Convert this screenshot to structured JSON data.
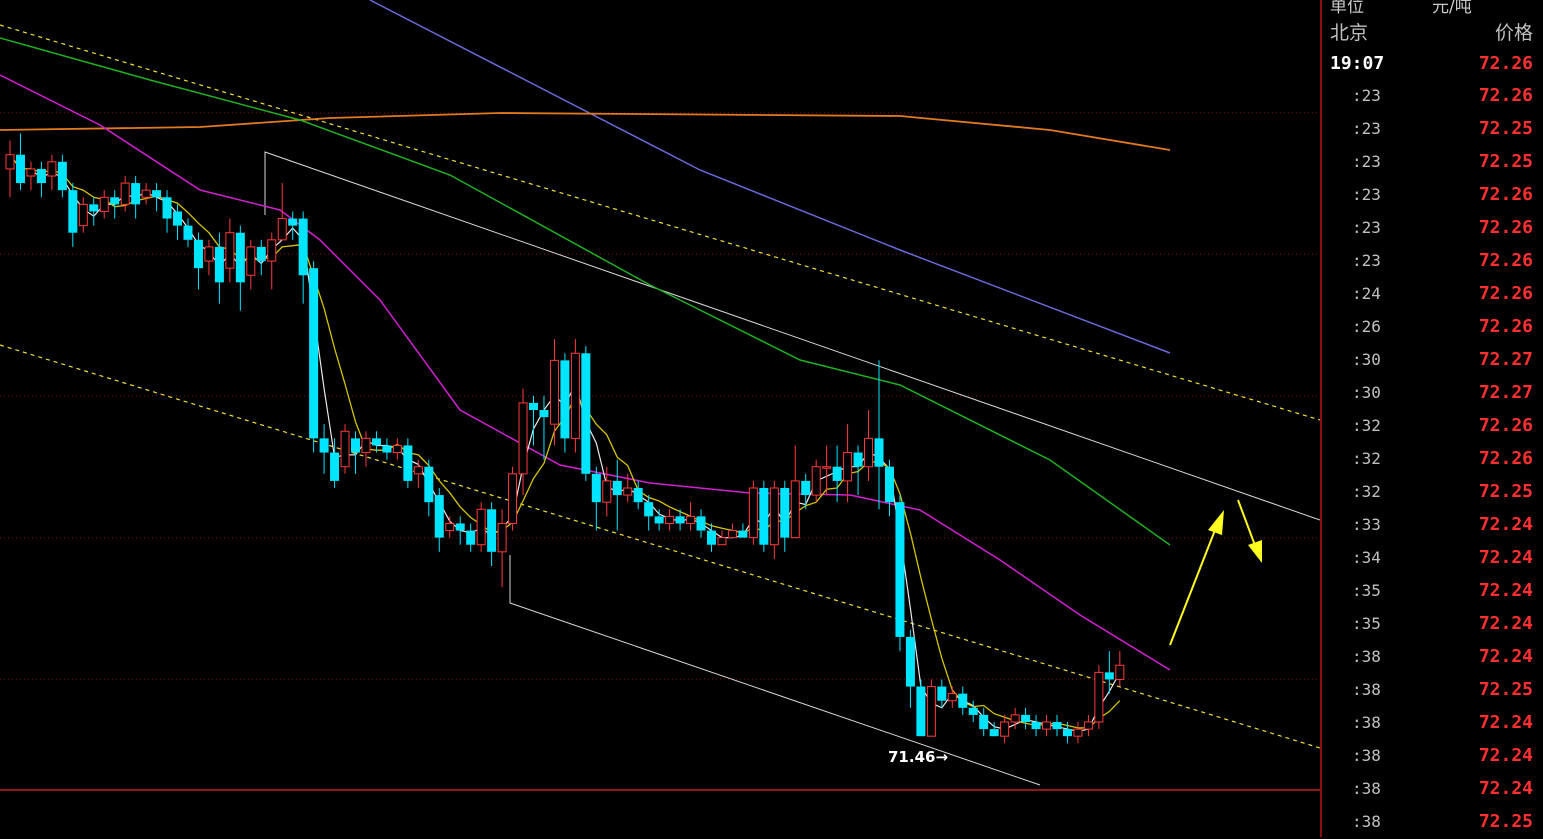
{
  "header": {
    "unit_label": "单位",
    "unit_value": "元/吨"
  },
  "panel": {
    "city": "北京",
    "price_header": "价格",
    "first": {
      "time": "19:07",
      "price": "72.26"
    },
    "rows": [
      {
        "time": ":23",
        "price": "72.26"
      },
      {
        "time": ":23",
        "price": "72.25"
      },
      {
        "time": ":23",
        "price": "72.25"
      },
      {
        "time": ":23",
        "price": "72.26"
      },
      {
        "time": ":23",
        "price": "72.26"
      },
      {
        "time": ":23",
        "price": "72.26"
      },
      {
        "time": ":24",
        "price": "72.26"
      },
      {
        "time": ":26",
        "price": "72.26"
      },
      {
        "time": ":30",
        "price": "72.27"
      },
      {
        "time": ":30",
        "price": "72.27"
      },
      {
        "time": ":32",
        "price": "72.26"
      },
      {
        "time": ":32",
        "price": "72.26"
      },
      {
        "time": ":32",
        "price": "72.25"
      },
      {
        "time": ":33",
        "price": "72.24"
      },
      {
        "time": ":34",
        "price": "72.24"
      },
      {
        "time": ":35",
        "price": "72.24"
      },
      {
        "time": ":35",
        "price": "72.24"
      },
      {
        "time": ":38",
        "price": "72.24"
      },
      {
        "time": ":38",
        "price": "72.25"
      },
      {
        "time": ":38",
        "price": "72.24"
      },
      {
        "time": ":38",
        "price": "72.24"
      },
      {
        "time": ":38",
        "price": "72.24"
      },
      {
        "time": ":38",
        "price": "72.25"
      }
    ]
  },
  "colors": {
    "up": "#ff3b3b",
    "down": "#00e5ff",
    "ma_white": "#e8e8e8",
    "ma_yellow": "#d4c400",
    "ma_magenta": "#d020d0",
    "ma_green": "#20b020",
    "ma_blue": "#6a6ad8",
    "ma_orange": "#e07a20",
    "channel_yellow": "#f0e030",
    "trend_white": "#d8d8d8",
    "grid": "#8a1010",
    "arrow": "#ffff20"
  },
  "chart_data": {
    "type": "candlestick",
    "ylim": [
      71.35,
      72.45
    ],
    "low_label": "71.46",
    "candles": [
      [
        72.24,
        72.26,
        72.2,
        72.28
      ],
      [
        72.26,
        72.22,
        72.21,
        72.29
      ],
      [
        72.23,
        72.24,
        72.21,
        72.25
      ],
      [
        72.24,
        72.22,
        72.2,
        72.25
      ],
      [
        72.23,
        72.25,
        72.21,
        72.26
      ],
      [
        72.25,
        72.21,
        72.2,
        72.26
      ],
      [
        72.21,
        72.15,
        72.13,
        72.22
      ],
      [
        72.16,
        72.19,
        72.15,
        72.2
      ],
      [
        72.19,
        72.18,
        72.16,
        72.2
      ],
      [
        72.18,
        72.2,
        72.17,
        72.21
      ],
      [
        72.2,
        72.19,
        72.17,
        72.21
      ],
      [
        72.19,
        72.22,
        72.18,
        72.23
      ],
      [
        72.22,
        72.19,
        72.17,
        72.23
      ],
      [
        72.2,
        72.21,
        72.19,
        72.22
      ],
      [
        72.21,
        72.2,
        72.18,
        72.22
      ],
      [
        72.2,
        72.17,
        72.15,
        72.21
      ],
      [
        72.18,
        72.16,
        72.14,
        72.19
      ],
      [
        72.16,
        72.14,
        72.13,
        72.17
      ],
      [
        72.14,
        72.1,
        72.07,
        72.15
      ],
      [
        72.11,
        72.13,
        72.09,
        72.14
      ],
      [
        72.13,
        72.08,
        72.05,
        72.15
      ],
      [
        72.1,
        72.15,
        72.08,
        72.17
      ],
      [
        72.15,
        72.08,
        72.04,
        72.16
      ],
      [
        72.09,
        72.13,
        72.07,
        72.14
      ],
      [
        72.13,
        72.11,
        72.09,
        72.14
      ],
      [
        72.11,
        72.14,
        72.07,
        72.15
      ],
      [
        72.14,
        72.17,
        72.14,
        72.22
      ],
      [
        72.17,
        72.16,
        72.14,
        72.18
      ],
      [
        72.17,
        72.09,
        72.05,
        72.18
      ],
      [
        72.1,
        71.86,
        71.84,
        72.11
      ],
      [
        71.86,
        71.84,
        71.81,
        71.88
      ],
      [
        71.84,
        71.8,
        71.79,
        71.86
      ],
      [
        71.82,
        71.87,
        71.81,
        71.88
      ],
      [
        71.86,
        71.84,
        71.81,
        71.87
      ],
      [
        71.84,
        71.86,
        71.82,
        71.87
      ],
      [
        71.86,
        71.85,
        71.84,
        71.87
      ],
      [
        71.85,
        71.84,
        71.83,
        71.86
      ],
      [
        71.84,
        71.85,
        71.83,
        71.86
      ],
      [
        71.85,
        71.8,
        71.79,
        71.86
      ],
      [
        71.81,
        71.82,
        71.79,
        71.83
      ],
      [
        71.82,
        71.77,
        71.75,
        71.83
      ],
      [
        71.78,
        71.72,
        71.7,
        71.79
      ],
      [
        71.73,
        71.74,
        71.72,
        71.75
      ],
      [
        71.74,
        71.73,
        71.71,
        71.75
      ],
      [
        71.73,
        71.71,
        71.7,
        71.74
      ],
      [
        71.71,
        71.76,
        71.7,
        71.77
      ],
      [
        71.76,
        71.7,
        71.68,
        71.77
      ],
      [
        71.7,
        71.74,
        71.65,
        71.76
      ],
      [
        71.74,
        71.81,
        71.73,
        71.82
      ],
      [
        71.81,
        71.91,
        71.78,
        71.93
      ],
      [
        71.91,
        71.9,
        71.85,
        71.92
      ],
      [
        71.9,
        71.89,
        71.83,
        71.92
      ],
      [
        71.88,
        71.97,
        71.85,
        72.0
      ],
      [
        71.97,
        71.86,
        71.84,
        71.98
      ],
      [
        71.86,
        71.98,
        71.84,
        72.0
      ],
      [
        71.98,
        71.81,
        71.8,
        71.99
      ],
      [
        71.81,
        71.77,
        71.73,
        71.82
      ],
      [
        71.77,
        71.8,
        71.75,
        71.82
      ],
      [
        71.8,
        71.78,
        71.73,
        71.83
      ],
      [
        71.78,
        71.79,
        71.77,
        71.81
      ],
      [
        71.79,
        71.77,
        71.76,
        71.8
      ],
      [
        71.77,
        71.75,
        71.73,
        71.78
      ],
      [
        71.75,
        71.74,
        71.73,
        71.76
      ],
      [
        71.74,
        71.75,
        71.73,
        71.76
      ],
      [
        71.75,
        71.74,
        71.73,
        71.76
      ],
      [
        71.74,
        71.75,
        71.73,
        71.77
      ],
      [
        71.75,
        71.73,
        71.72,
        71.76
      ],
      [
        71.73,
        71.71,
        71.7,
        71.74
      ],
      [
        71.71,
        71.72,
        71.71,
        71.73
      ],
      [
        71.72,
        71.73,
        71.72,
        71.74
      ],
      [
        71.73,
        71.72,
        71.72,
        71.74
      ],
      [
        71.72,
        71.79,
        71.71,
        71.8
      ],
      [
        71.79,
        71.71,
        71.7,
        71.8
      ],
      [
        71.71,
        71.79,
        71.69,
        71.8
      ],
      [
        71.79,
        71.72,
        71.7,
        71.8
      ],
      [
        71.72,
        71.8,
        71.72,
        71.85
      ],
      [
        71.8,
        71.78,
        71.76,
        71.81
      ],
      [
        71.78,
        71.82,
        71.77,
        71.83
      ],
      [
        71.82,
        71.82,
        71.78,
        71.85
      ],
      [
        71.82,
        71.8,
        71.77,
        71.85
      ],
      [
        71.8,
        71.84,
        71.77,
        71.88
      ],
      [
        71.84,
        71.82,
        71.78,
        71.85
      ],
      [
        71.82,
        71.86,
        71.8,
        71.9
      ],
      [
        71.86,
        71.82,
        71.76,
        71.97
      ],
      [
        71.82,
        71.77,
        71.75,
        71.83
      ],
      [
        71.77,
        71.58,
        71.56,
        71.78
      ],
      [
        71.58,
        71.51,
        71.48,
        71.59
      ],
      [
        71.51,
        71.44,
        71.46,
        71.52
      ],
      [
        71.44,
        71.51,
        71.45,
        71.52
      ],
      [
        71.51,
        71.49,
        71.48,
        71.52
      ],
      [
        71.49,
        71.5,
        71.48,
        71.51
      ],
      [
        71.5,
        71.48,
        71.47,
        71.51
      ],
      [
        71.48,
        71.47,
        71.46,
        71.49
      ],
      [
        71.47,
        71.45,
        71.44,
        71.48
      ],
      [
        71.45,
        71.44,
        71.44,
        71.46
      ],
      [
        71.44,
        71.46,
        71.43,
        71.47
      ],
      [
        71.46,
        71.47,
        71.45,
        71.48
      ],
      [
        71.47,
        71.46,
        71.45,
        71.48
      ],
      [
        71.46,
        71.45,
        71.44,
        71.47
      ],
      [
        71.45,
        71.46,
        71.44,
        71.47
      ],
      [
        71.46,
        71.45,
        71.44,
        71.47
      ],
      [
        71.45,
        71.44,
        71.43,
        71.46
      ],
      [
        71.44,
        71.45,
        71.43,
        71.46
      ],
      [
        71.45,
        71.46,
        71.44,
        71.47
      ],
      [
        71.46,
        71.53,
        71.45,
        71.54
      ],
      [
        71.53,
        71.52,
        71.5,
        71.56
      ],
      [
        71.52,
        71.54,
        71.51,
        71.56
      ]
    ]
  }
}
